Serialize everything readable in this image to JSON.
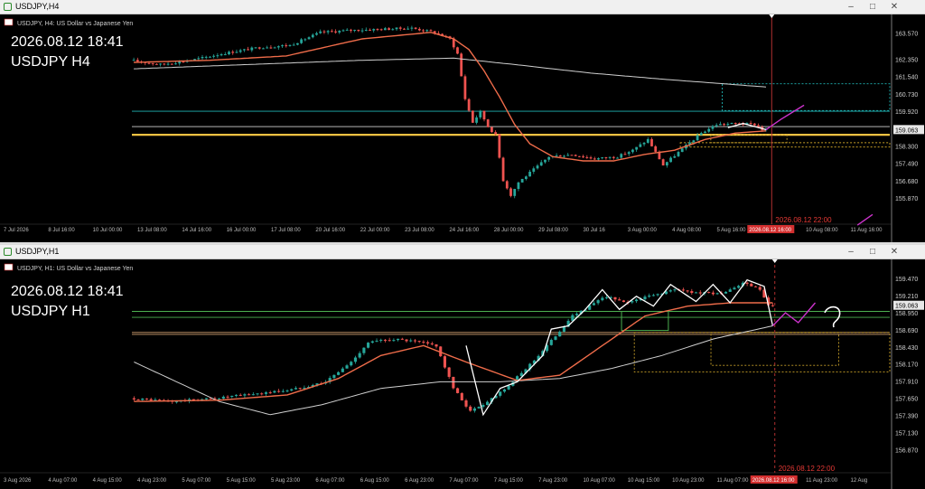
{
  "windows": [
    {
      "window_title": "USDJPY,H4",
      "symbol_info": "USDJPY, H4:  US Dollar vs Japanese Yen",
      "overlay_datetime": "2026.08.12 18:41",
      "overlay_symbol": "USDJPY H4",
      "current_price": "159.063",
      "time_label": "2026.08.12 22:00",
      "time_badge": "2026.08.12 16:00"
    },
    {
      "window_title": "USDJPY,H1",
      "symbol_info": "USDJPY, H1:  US Dollar vs Japanese Yen",
      "overlay_datetime": "2026.08.12 18:41",
      "overlay_symbol": "USDJPY H1",
      "current_price": "159.063",
      "time_label": "2026.08.12 22:00",
      "time_badge": "2026.08.12 16:00"
    }
  ],
  "colors": {
    "background": "#000000",
    "candle_up": "#26a69a",
    "candle_down": "#ef5350",
    "ma_fast": "#ef6c4a",
    "ma_slow": "#d0d0d0",
    "support_line": "#f5c242",
    "annotation": "#cc33cc",
    "zigzag": "#ffffff",
    "level_cyan": "#1fb5b5",
    "level_green": "#4caf50",
    "level_tan": "#d2a070",
    "dotted_box": "#c8a028",
    "vline": "#b03030",
    "badge": "#d32f2f"
  },
  "chart_data": [
    {
      "type": "candlestick",
      "timeframe": "H4",
      "ylim": [
        154.9,
        164.1
      ],
      "yticks": [
        163.57,
        162.35,
        161.54,
        160.73,
        159.92,
        159.063,
        158.3,
        157.49,
        156.68,
        155.87
      ],
      "ytick_labels": [
        "163.570",
        "162.350",
        "161.540",
        "160.730",
        "159.920",
        "159.063",
        "158.300",
        "157.490",
        "156.680",
        "155.870"
      ],
      "xtick_labels": [
        "7 Jul 2026",
        "8 Jul 16:00",
        "10 Jul 00:00",
        "13 Jul 08:00",
        "14 Jul 16:00",
        "16 Jul 00:00",
        "17 Jul 08:00",
        "20 Jul 16:00",
        "22 Jul 00:00",
        "23 Jul 08:00",
        "24 Jul 16:00",
        "28 Jul 00:00",
        "29 Jul 08:00",
        "30 Jul 16",
        "3 Aug 00:00",
        "4 Aug 08:00",
        "5 Aug 16:00",
        "7 Aug 00:00",
        "10 Aug 08:00",
        "11 Aug 16:00"
      ],
      "price_anchors": [
        [
          0,
          162.3
        ],
        [
          8,
          162.1
        ],
        [
          16,
          162.3
        ],
        [
          24,
          162.6
        ],
        [
          34,
          162.9
        ],
        [
          42,
          163.0
        ],
        [
          50,
          163.6
        ],
        [
          58,
          163.7
        ],
        [
          66,
          163.75
        ],
        [
          74,
          163.8
        ],
        [
          80,
          163.6
        ],
        [
          84,
          163.3
        ],
        [
          86,
          162.6
        ],
        [
          88,
          160.5
        ],
        [
          90,
          159.4
        ],
        [
          92,
          159.9
        ],
        [
          94,
          159.2
        ],
        [
          96,
          158.8
        ],
        [
          98,
          156.7
        ],
        [
          100,
          156.0
        ],
        [
          102,
          156.6
        ],
        [
          106,
          157.2
        ],
        [
          110,
          157.8
        ],
        [
          116,
          157.9
        ],
        [
          122,
          157.7
        ],
        [
          128,
          157.8
        ],
        [
          132,
          158.1
        ],
        [
          136,
          158.6
        ],
        [
          138,
          158.0
        ],
        [
          140,
          157.4
        ],
        [
          142,
          157.7
        ],
        [
          146,
          158.3
        ],
        [
          150,
          158.9
        ],
        [
          154,
          159.3
        ],
        [
          160,
          159.35
        ],
        [
          164,
          159.3
        ],
        [
          166,
          159.06
        ]
      ],
      "ma_fast_anchors": [
        [
          0,
          162.2
        ],
        [
          20,
          162.3
        ],
        [
          40,
          162.5
        ],
        [
          60,
          163.3
        ],
        [
          78,
          163.6
        ],
        [
          84,
          163.3
        ],
        [
          88,
          162.8
        ],
        [
          92,
          161.8
        ],
        [
          96,
          160.6
        ],
        [
          100,
          159.3
        ],
        [
          104,
          158.4
        ],
        [
          110,
          157.8
        ],
        [
          118,
          157.6
        ],
        [
          126,
          157.6
        ],
        [
          134,
          157.9
        ],
        [
          142,
          158.1
        ],
        [
          150,
          158.6
        ],
        [
          158,
          158.9
        ],
        [
          166,
          159.0
        ]
      ],
      "ma_slow_anchors": [
        [
          0,
          161.9
        ],
        [
          30,
          162.1
        ],
        [
          60,
          162.3
        ],
        [
          84,
          162.4
        ],
        [
          100,
          162.1
        ],
        [
          120,
          161.7
        ],
        [
          140,
          161.4
        ],
        [
          155,
          161.2
        ],
        [
          166,
          161.05
        ]
      ],
      "zigzag_anchors": [
        [
          156,
          159.15
        ],
        [
          160,
          159.35
        ],
        [
          166,
          159.06
        ]
      ],
      "levels": [
        {
          "price": 159.92,
          "color": "level_cyan",
          "start": 0
        },
        {
          "price": 159.2,
          "color": "ma_slow",
          "start": 0
        },
        {
          "price": 158.82,
          "color": "support_line",
          "start": 0,
          "thick": true
        }
      ],
      "dotted_rects": [
        {
          "i0": 152,
          "i1": 172,
          "p0": 158.45,
          "p1": 158.82,
          "color": "dotted_box"
        },
        {
          "i0": 144,
          "i1": 198,
          "p0": 158.25,
          "p1": 158.45,
          "color": "dotted_box",
          "open_right": true
        },
        {
          "i0": 155,
          "i1": 198,
          "p0": 159.95,
          "p1": 161.2,
          "color": "level_cyan",
          "open_right": true
        }
      ],
      "n_candles": 167,
      "n_slots": 199,
      "vline_index": 168,
      "annotation_path": [
        [
          166,
          159.06
        ],
        [
          170,
          159.55
        ],
        [
          176,
          160.2
        ]
      ],
      "annotation_tail": [
        [
          194,
          155.1
        ],
        [
          190,
          154.6
        ]
      ]
    },
    {
      "type": "candlestick",
      "timeframe": "H1",
      "ylim": [
        156.6,
        159.65
      ],
      "yticks": [
        159.47,
        159.21,
        159.063,
        158.95,
        158.69,
        158.43,
        158.17,
        157.91,
        157.65,
        157.39,
        157.13,
        156.87
      ],
      "ytick_labels": [
        "159.470",
        "159.210",
        "159.063",
        "158.950",
        "158.690",
        "158.430",
        "158.170",
        "157.910",
        "157.650",
        "157.390",
        "157.130",
        "156.870"
      ],
      "xtick_labels": [
        "3 Aug 2026",
        "4 Aug 07:00",
        "4 Aug 15:00",
        "4 Aug 23:00",
        "5 Aug 07:00",
        "5 Aug 15:00",
        "5 Aug 23:00",
        "6 Aug 07:00",
        "6 Aug 15:00",
        "6 Aug 23:00",
        "7 Aug 07:00",
        "7 Aug 15:00",
        "7 Aug 23:00",
        "10 Aug 07:00",
        "10 Aug 15:00",
        "10 Aug 23:00",
        "11 Aug 07:00",
        "11 Aug 15:00",
        "11 Aug 23:00",
        "12 Aug"
      ],
      "price_anchors": [
        [
          0,
          157.65
        ],
        [
          10,
          157.6
        ],
        [
          20,
          157.65
        ],
        [
          30,
          157.72
        ],
        [
          38,
          157.78
        ],
        [
          46,
          157.9
        ],
        [
          52,
          158.2
        ],
        [
          56,
          158.5
        ],
        [
          62,
          158.55
        ],
        [
          68,
          158.5
        ],
        [
          72,
          158.45
        ],
        [
          76,
          157.8
        ],
        [
          80,
          157.45
        ],
        [
          84,
          157.6
        ],
        [
          90,
          157.9
        ],
        [
          96,
          158.3
        ],
        [
          100,
          158.6
        ],
        [
          104,
          158.9
        ],
        [
          108,
          159.05
        ],
        [
          112,
          159.2
        ],
        [
          116,
          159.1
        ],
        [
          122,
          159.2
        ],
        [
          128,
          159.3
        ],
        [
          134,
          159.25
        ],
        [
          140,
          159.25
        ],
        [
          144,
          159.4
        ],
        [
          148,
          159.3
        ],
        [
          150,
          159.05
        ]
      ],
      "ma_fast_anchors": [
        [
          0,
          157.6
        ],
        [
          20,
          157.62
        ],
        [
          36,
          157.7
        ],
        [
          48,
          157.95
        ],
        [
          58,
          158.3
        ],
        [
          68,
          158.45
        ],
        [
          78,
          158.2
        ],
        [
          90,
          157.92
        ],
        [
          100,
          158.0
        ],
        [
          110,
          158.45
        ],
        [
          120,
          158.9
        ],
        [
          130,
          159.05
        ],
        [
          140,
          159.1
        ],
        [
          150,
          159.1
        ]
      ],
      "ma_slow_anchors": [
        [
          0,
          158.2
        ],
        [
          20,
          157.6
        ],
        [
          32,
          157.4
        ],
        [
          44,
          157.55
        ],
        [
          58,
          157.8
        ],
        [
          72,
          157.9
        ],
        [
          86,
          157.9
        ],
        [
          100,
          157.95
        ],
        [
          112,
          158.1
        ],
        [
          124,
          158.3
        ],
        [
          136,
          158.55
        ],
        [
          150,
          158.75
        ]
      ],
      "zigzag_anchors": [
        [
          78,
          158.45
        ],
        [
          82,
          157.4
        ],
        [
          86,
          157.8
        ],
        [
          90,
          157.9
        ],
        [
          96,
          158.3
        ],
        [
          98,
          158.7
        ],
        [
          102,
          158.75
        ],
        [
          106,
          159.0
        ],
        [
          110,
          159.3
        ],
        [
          114,
          159.0
        ],
        [
          118,
          159.2
        ],
        [
          122,
          159.05
        ],
        [
          126,
          159.38
        ],
        [
          132,
          159.12
        ],
        [
          136,
          159.38
        ],
        [
          140,
          159.1
        ],
        [
          144,
          159.45
        ],
        [
          148,
          159.35
        ],
        [
          150,
          158.75
        ]
      ],
      "levels": [
        {
          "price": 158.97,
          "color": "level_green",
          "start": 0
        },
        {
          "price": 158.88,
          "color": "level_green",
          "start": 0
        },
        {
          "price": 158.65,
          "color": "level_tan",
          "start": 0
        },
        {
          "price": 158.62,
          "color": "level_tan",
          "start": 0
        }
      ],
      "solid_rects": [
        {
          "i0": 115,
          "i1": 126,
          "p0": 158.68,
          "p1": 158.97,
          "color": "level_green"
        }
      ],
      "dotted_rects": [
        {
          "i0": 118,
          "i1": 175,
          "p0": 158.05,
          "p1": 158.65,
          "color": "dotted_box",
          "open_right": true
        },
        {
          "i0": 136,
          "i1": 166,
          "p0": 158.15,
          "p1": 158.65,
          "color": "dotted_box"
        }
      ],
      "n_candles": 151,
      "n_slots": 178,
      "vline_index": 151,
      "annotation_path": [
        [
          150,
          158.75
        ],
        [
          153,
          158.95
        ],
        [
          156,
          158.8
        ],
        [
          160,
          159.1
        ]
      ]
    }
  ]
}
